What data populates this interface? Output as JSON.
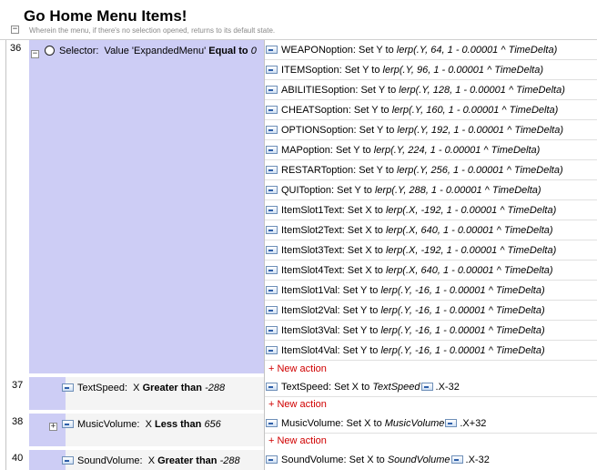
{
  "group": {
    "title": "Go Home Menu Items!",
    "description": "Wherein the menu, if there's no selection opened, returns to its default state.",
    "collapse_symbol": "−"
  },
  "events": [
    {
      "number": "36",
      "toggle": "−",
      "condition": {
        "object": "Selector:",
        "prefix": "Value 'ExpandedMenu'",
        "operator": "Equal to",
        "value": "0"
      },
      "actions": [
        {
          "object": "WEAPONoption:",
          "verb": "Set Y to",
          "expr": "lerp(.Y, 64, 1 - 0.00001 ^ TimeDelta)"
        },
        {
          "object": "ITEMSoption:",
          "verb": "Set Y to",
          "expr": "lerp(.Y, 96, 1 - 0.00001 ^ TimeDelta)"
        },
        {
          "object": "ABILITIESoption:",
          "verb": "Set Y to",
          "expr": "lerp(.Y, 128, 1 - 0.00001 ^ TimeDelta)"
        },
        {
          "object": "CHEATSoption:",
          "verb": "Set Y to",
          "expr": "lerp(.Y, 160, 1 - 0.00001 ^ TimeDelta)"
        },
        {
          "object": "OPTIONSoption:",
          "verb": "Set Y to",
          "expr": "lerp(.Y, 192, 1 - 0.00001 ^ TimeDelta)"
        },
        {
          "object": "MAPoption:",
          "verb": "Set Y to",
          "expr": "lerp(.Y, 224, 1 - 0.00001 ^ TimeDelta)"
        },
        {
          "object": "RESTARToption:",
          "verb": "Set Y to",
          "expr": "lerp(.Y, 256, 1 - 0.00001 ^ TimeDelta)"
        },
        {
          "object": "QUIToption:",
          "verb": "Set Y to",
          "expr": "lerp(.Y, 288, 1 - 0.00001 ^ TimeDelta)"
        },
        {
          "object": "ItemSlot1Text:",
          "verb": "Set X to",
          "expr": "lerp(.X, -192, 1 - 0.00001 ^ TimeDelta)"
        },
        {
          "object": "ItemSlot2Text:",
          "verb": "Set X to",
          "expr": "lerp(.X, 640, 1 - 0.00001 ^ TimeDelta)"
        },
        {
          "object": "ItemSlot3Text:",
          "verb": "Set X to",
          "expr": "lerp(.X, -192, 1 - 0.00001 ^ TimeDelta)"
        },
        {
          "object": "ItemSlot4Text:",
          "verb": "Set X to",
          "expr": "lerp(.X, 640, 1 - 0.00001 ^ TimeDelta)"
        },
        {
          "object": "ItemSlot1Val:",
          "verb": "Set Y to",
          "expr": "lerp(.Y, -16, 1 - 0.00001 ^ TimeDelta)"
        },
        {
          "object": "ItemSlot2Val:",
          "verb": "Set Y to",
          "expr": "lerp(.Y, -16, 1 - 0.00001 ^ TimeDelta)"
        },
        {
          "object": "ItemSlot3Val:",
          "verb": "Set Y to",
          "expr": "lerp(.Y, -16, 1 - 0.00001 ^ TimeDelta)"
        },
        {
          "object": "ItemSlot4Val:",
          "verb": "Set Y to",
          "expr": "lerp(.Y, -16, 1 - 0.00001 ^ TimeDelta)"
        }
      ],
      "new_action": "+ New action"
    },
    {
      "number": "37",
      "condition": {
        "object": "TextSpeed:",
        "prefix": "X",
        "operator": "Greater than",
        "value": "-288"
      },
      "action": {
        "object": "TextSpeed:",
        "verb": "Set X to",
        "ref": "TextSpeed",
        "suffix": ".X-32"
      },
      "new_action": "+ New action"
    },
    {
      "number": "38",
      "toggle": "+",
      "condition": {
        "object": "MusicVolume:",
        "prefix": "X",
        "operator": "Less than",
        "value": "656"
      },
      "action": {
        "object": "MusicVolume:",
        "verb": "Set X to",
        "ref": "MusicVolume",
        "suffix": ".X+32"
      },
      "new_action": "+ New action"
    },
    {
      "number": "40",
      "condition": {
        "object": "SoundVolume:",
        "prefix": "X",
        "operator": "Greater than",
        "value": "-288"
      },
      "action": {
        "object": "SoundVolume:",
        "verb": "Set X to",
        "ref": "SoundVolume",
        "suffix": ".X-32"
      }
    }
  ],
  "colors": {
    "condition_bg": "#cdcdf5",
    "new_action_text": "#d00000",
    "description_text": "#8a8a8a"
  },
  "icons": {
    "object_icon": "object-type-icon",
    "condition_icon": "system-circle-icon"
  }
}
